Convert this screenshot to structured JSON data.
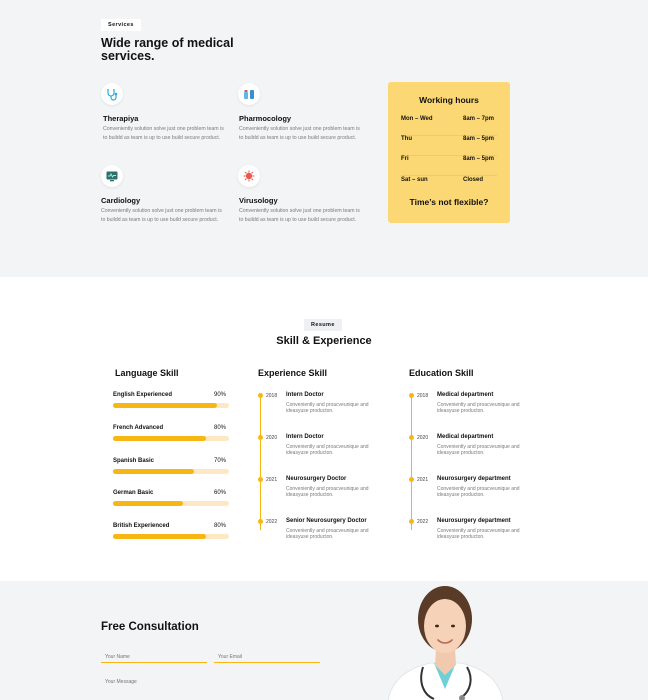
{
  "services": {
    "tag": "Services",
    "title": "Wide range of medical services.",
    "items": [
      {
        "name": "Therapiya",
        "icon": "stethoscope-icon",
        "desc": "Conveniently solution solve just one problem team is to buildd as team is up to use build secure product."
      },
      {
        "name": "Pharmocology",
        "icon": "pills-icon",
        "desc": "Conveniently solution solve just one problem team is to buildd as team is up to use build secure product."
      },
      {
        "name": "Cardiology",
        "icon": "heart-monitor-icon",
        "desc": "Conveniently solution solve just one problem team is to buildd as team is up to use build secure product."
      },
      {
        "name": "Virusology",
        "icon": "virus-icon",
        "desc": "Conveniently solution solve just one problem team is to buildd as team is up to use build secure product."
      }
    ]
  },
  "hours": {
    "title": "Working hours",
    "rows": [
      {
        "day": "Mon – Wed",
        "time": "8am – 7pm"
      },
      {
        "day": "Thu",
        "time": "8am – 5pm"
      },
      {
        "day": "Fri",
        "time": "8am – 5pm"
      },
      {
        "day": "Sat – sun",
        "time": "Closed"
      }
    ],
    "footer": "Time’s not flexible?"
  },
  "resume": {
    "tag": "Resume",
    "title": "Skill & Experience",
    "language": {
      "title": "Language Skill",
      "skills": [
        {
          "name": "English Experienced",
          "percent_label": "90%",
          "level": 0.9
        },
        {
          "name": "French Advanced",
          "percent_label": "80%",
          "level": 0.8
        },
        {
          "name": "Spanish Basic",
          "percent_label": "70%",
          "level": 0.7
        },
        {
          "name": "German Basic",
          "percent_label": "60%",
          "level": 0.6
        },
        {
          "name": "British Experienced",
          "percent_label": "80%",
          "level": 0.8
        }
      ]
    },
    "experience": {
      "title": "Experience Skill",
      "items": [
        {
          "year": "2018",
          "title": "Intern Doctor",
          "desc": "Conveniently and proacveunique and ideasyuse producton."
        },
        {
          "year": "2020",
          "title": "Intern Doctor",
          "desc": "Conveniently and proacveunique and ideasyuse producton."
        },
        {
          "year": "2021",
          "title": "Neurosurgery Doctor",
          "desc": "Conveniently and proacveunique and ideasyuse producton."
        },
        {
          "year": "2022",
          "title": "Senior Neurosurgery Doctor",
          "desc": "Conveniently and proacveunique and ideasyuse producton."
        }
      ]
    },
    "education": {
      "title": "Education Skill",
      "items": [
        {
          "year": "2018",
          "title": "Medical department",
          "desc": "Conveniently and proacveunique and ideasyuse producton."
        },
        {
          "year": "2020",
          "title": "Medical department",
          "desc": "Conveniently and proacveunique and ideasyuse producton."
        },
        {
          "year": "2021",
          "title": "Neurosurgery department",
          "desc": "Conveniently and proacveunique and ideasyuse producton."
        },
        {
          "year": "2022",
          "title": "Neurosurgery department",
          "desc": "Conveniently and proacveunique and ideasyuse producton."
        }
      ]
    }
  },
  "consultation": {
    "title": "Free Consultation",
    "name_placeholder": "Your Name",
    "email_placeholder": "Your Email",
    "message_placeholder": "Your Message"
  },
  "colors": {
    "accent": "#f7b614",
    "hours_card": "#fbd874",
    "section_bg": "#f3f4f6"
  }
}
